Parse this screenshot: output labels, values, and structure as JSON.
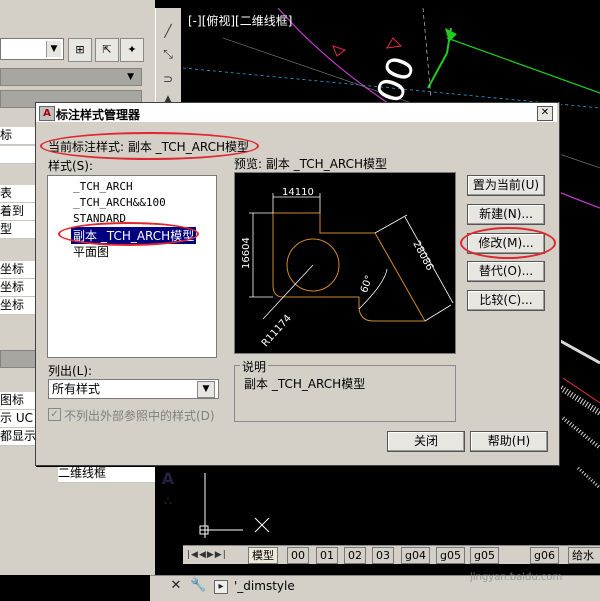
{
  "canvas": {
    "view_label": "[-][俯视][二维线框]",
    "text_fragment": "00"
  },
  "left_panel": {
    "rows": [
      "标",
      "",
      "表",
      "着到",
      "型",
      "",
      "坐标",
      "坐标",
      "坐标",
      "",
      "",
      "",
      "",
      "",
      "图标",
      "示 UC",
      "都显示",
      "",
      "二维线框"
    ]
  },
  "dialog": {
    "title": "标注样式管理器",
    "app_icon_text": "A",
    "current_style_label": "当前标注样式: 副本 _TCH_ARCH模型",
    "styles_label": "样式(S):",
    "styles": [
      "_TCH_ARCH",
      "_TCH_ARCH&&100",
      "STANDARD",
      "副本 _TCH_ARCH模型",
      "平面图"
    ],
    "preview_label": "预览: 副本 _TCH_ARCH模型",
    "list_label": "列出(L):",
    "list_value": "所有样式",
    "xref_label": "不列出外部参照中的样式(D)",
    "description_label": "说明",
    "description_text": "副本 _TCH_ARCH模型",
    "buttons": {
      "set_current": "置为当前(U)",
      "new": "新建(N)...",
      "modify": "修改(M)...",
      "override": "替代(O)...",
      "compare": "比较(C)...",
      "close": "关闭",
      "help": "帮助(H)"
    },
    "preview_dims": {
      "top": "14110",
      "left": "16604",
      "diagonal": "28086",
      "angle": "60°",
      "radius": "R11174"
    }
  },
  "tabs": [
    "模型",
    "00",
    "01",
    "02",
    "03",
    "g04",
    "g05",
    "g05",
    "g06",
    "给水"
  ],
  "command_line": {
    "text": "'_dimstyle"
  },
  "watermark": "jingyan.baidu.com",
  "colors": {
    "highlight_ring": "#e0262e",
    "selection": "#000080",
    "preview_geometry": "#d08a2a"
  }
}
